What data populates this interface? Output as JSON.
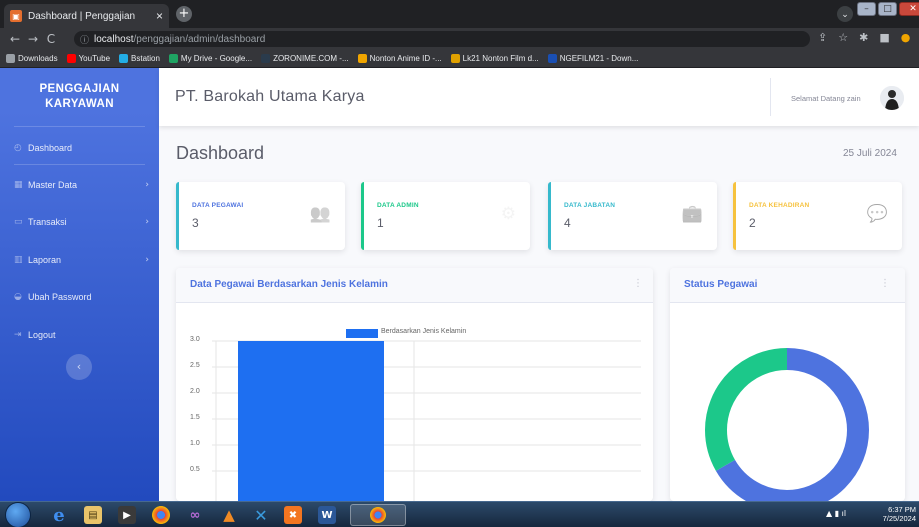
{
  "browser": {
    "tab_title": "Dashboard | Penggajian",
    "tab_close": "×",
    "newtab": "+",
    "url_host": "localhost",
    "url_path": "/penggajian/admin/dashboard",
    "bookmarks": [
      {
        "label": "Downloads",
        "color": "#9aa0a6"
      },
      {
        "label": "YouTube",
        "color": "#ff0000"
      },
      {
        "label": "Bstation",
        "color": "#23ade5"
      },
      {
        "label": "My Drive - Google...",
        "color": "#1fa463"
      },
      {
        "label": "ZORONIME.COM -...",
        "color": "#2a3b4c"
      },
      {
        "label": "Nonton Anime ID -...",
        "color": "#f0a500"
      },
      {
        "label": "Lk21 Nonton Film d...",
        "color": "#e0a100"
      },
      {
        "label": "NGEFILM21 - Down...",
        "color": "#1a4fb3"
      }
    ]
  },
  "sidebar": {
    "brand_line1": "PENGGAJIAN",
    "brand_line2": "KARYAWAN",
    "items": [
      {
        "label": "Dashboard",
        "icon": "dashboard-icon",
        "has_chevron": false
      },
      {
        "label": "Master Data",
        "icon": "database-icon",
        "has_chevron": true
      },
      {
        "label": "Transaksi",
        "icon": "money-icon",
        "has_chevron": true
      },
      {
        "label": "Laporan",
        "icon": "file-icon",
        "has_chevron": true
      },
      {
        "label": "Ubah Password",
        "icon": "lock-icon",
        "has_chevron": false
      },
      {
        "label": "Logout",
        "icon": "logout-icon",
        "has_chevron": false
      }
    ]
  },
  "topbar": {
    "company": "PT. Barokah Utama Karya",
    "greeting": "Selamat Datang zain"
  },
  "page": {
    "title": "Dashboard",
    "date": "25 Juli 2024"
  },
  "cards": [
    {
      "label": "DATA PEGAWAI",
      "value": "3",
      "color": "#36b9cc",
      "label_color": "#4e73df",
      "icon": "users-icon"
    },
    {
      "label": "DATA ADMIN",
      "value": "1",
      "color": "#1cc88a",
      "label_color": "#1cc88a",
      "icon": "user-cog-icon"
    },
    {
      "label": "DATA JABATAN",
      "value": "4",
      "color": "#36b9cc",
      "label_color": "#36b9cc",
      "icon": "briefcase-icon"
    },
    {
      "label": "DATA KEHADIRAN",
      "value": "2",
      "color": "#f6c23e",
      "label_color": "#f6c23e",
      "icon": "comments-icon"
    }
  ],
  "panels": {
    "bar_title": "Data Pegawai Berdasarkan Jenis Kelamin",
    "donut_title": "Status Pegawai"
  },
  "chart_data": [
    {
      "type": "bar",
      "title": "",
      "legend": "Berdasarkan Jenis Kelamin",
      "series_color": "#1e6ff1",
      "categories": [
        ""
      ],
      "values": [
        3
      ],
      "yticks": [
        "3.0",
        "2.5",
        "2.0",
        "1.5",
        "1.0",
        "0.5"
      ],
      "ylim": [
        0,
        3
      ]
    },
    {
      "type": "pie",
      "donut": true,
      "slices": [
        {
          "value": 2,
          "color": "#4e73df"
        },
        {
          "value": 1,
          "color": "#1cc88a"
        }
      ]
    }
  ],
  "taskbar": {
    "time": "6:37 PM",
    "date": "7/25/2024",
    "tray": "▲  ▮  ıl"
  }
}
